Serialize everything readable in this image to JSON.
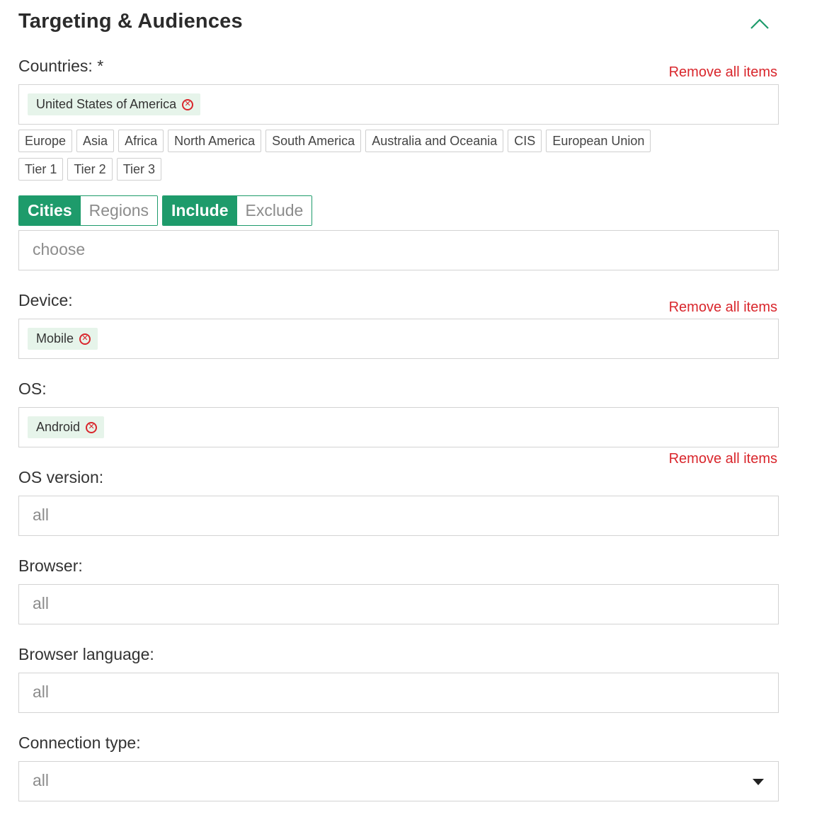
{
  "section": {
    "title": "Targeting & Audiences"
  },
  "countries": {
    "label": "Countries: *",
    "remove_all": "Remove all items",
    "selected": [
      "United States of America"
    ],
    "regions": [
      "Europe",
      "Asia",
      "Africa",
      "North America",
      "South America",
      "Australia and Oceania",
      "CIS",
      "European Union"
    ],
    "tiers": [
      "Tier 1",
      "Tier 2",
      "Tier 3"
    ]
  },
  "geo_toggle": {
    "cities": "Cities",
    "regions": "Regions",
    "include": "Include",
    "exclude": "Exclude",
    "placeholder": "choose"
  },
  "device": {
    "label": "Device:",
    "remove_all": "Remove all items",
    "selected": [
      "Mobile"
    ]
  },
  "os": {
    "label": "OS:",
    "remove_all": "Remove all items",
    "selected": [
      "Android"
    ]
  },
  "os_version": {
    "label": "OS version:",
    "placeholder": "all"
  },
  "browser": {
    "label": "Browser:",
    "placeholder": "all"
  },
  "browser_language": {
    "label": "Browser language:",
    "placeholder": "all"
  },
  "connection_type": {
    "label": "Connection type:",
    "placeholder": "all"
  },
  "icons": {
    "collapse": "chevron-up-icon",
    "remove_tag": "close-circle-icon",
    "dropdown": "caret-down-icon"
  },
  "colors": {
    "accent": "#1e9b6b",
    "danger": "#d9262c",
    "tag_bg": "#e6f4ea"
  }
}
